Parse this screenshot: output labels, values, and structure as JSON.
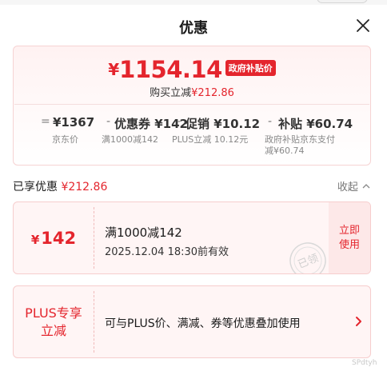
{
  "header": {
    "title": "优惠"
  },
  "summary": {
    "currency": "¥",
    "final_price": "1154.14",
    "gov_tag": "政府补贴价",
    "buy_prefix": "购买立减",
    "buy_amount": "¥212.86",
    "breakdown": [
      {
        "op": "=",
        "value": "¥1367",
        "label": "京东价"
      },
      {
        "op": "-",
        "value": "优惠券 ¥142",
        "label": "满1000减142"
      },
      {
        "op": "-",
        "value": "促销 ¥10.12",
        "label": "PLUS立减 10.12元"
      },
      {
        "op": "-",
        "value": "补贴 ¥60.74",
        "label_line1": "政府补贴京东支付",
        "label_line2": "减¥60.74"
      }
    ]
  },
  "enjoyed": {
    "prefix": "已享优惠",
    "amount": "¥212.86",
    "collapse_label": "收起"
  },
  "coupon": {
    "currency": "¥",
    "amount": "142",
    "condition": "满1000减142",
    "validity": "2025.12.04 18:30前有效",
    "stamp_text": "已领",
    "use_label": "立即使用"
  },
  "plus": {
    "label": "PLUS专享立减",
    "description": "可与PLUS价、满减、券等优惠叠加使用"
  },
  "watermark": "SPdtyh",
  "colors": {
    "accent": "#e4252d",
    "card_bg": "#fff5f5",
    "border": "#f6cdcd"
  },
  "icons": {
    "close": "close-icon",
    "collapse": "chevron-up-icon",
    "more": "chevron-right-icon"
  }
}
